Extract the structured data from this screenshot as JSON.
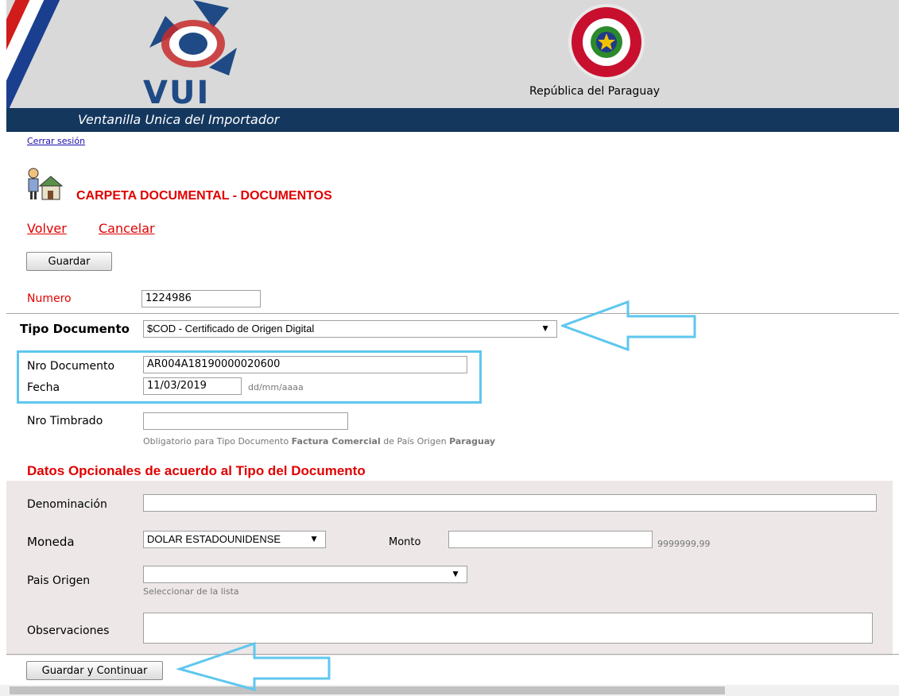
{
  "header": {
    "logo_text": "VUI",
    "country": "República del Paraguay",
    "tagline": "Ventanilla Unica del Importador"
  },
  "session": {
    "logout": "Cerrar sesión"
  },
  "page": {
    "title": "CARPETA DOCUMENTAL - DOCUMENTOS",
    "nav": {
      "back": "Volver",
      "cancel": "Cancelar"
    },
    "save": "Guardar",
    "save_continue": "Guardar y Continuar"
  },
  "form": {
    "numero": {
      "label": "Numero",
      "value": "1224986"
    },
    "tipo_documento": {
      "label": "Tipo Documento",
      "value": "$COD - Certificado de Origen Digital"
    },
    "nro_documento": {
      "label": "Nro Documento",
      "value": "AR004A18190000020600"
    },
    "fecha": {
      "label": "Fecha",
      "value": "11/03/2019",
      "format_hint": "dd/mm/aaaa"
    },
    "nro_timbrado": {
      "label": "Nro Timbrado",
      "value": "",
      "hint_prefix": "Obligatorio para Tipo Documento ",
      "hint_bold1": "Factura Comercial",
      "hint_mid": " de País Origen ",
      "hint_bold2": "Paraguay"
    }
  },
  "optional": {
    "title": "Datos Opcionales de acuerdo al Tipo del Documento",
    "denominacion": {
      "label": "Denominación",
      "value": ""
    },
    "moneda": {
      "label": "Moneda",
      "value": "DOLAR ESTADOUNIDENSE"
    },
    "monto": {
      "label": "Monto",
      "value": "",
      "format_hint": "9999999,99"
    },
    "pais_origen": {
      "label": "Pais Origen",
      "value": "",
      "hint": "Seleccionar de la lista"
    },
    "observaciones": {
      "label": "Observaciones",
      "value": ""
    }
  },
  "icons": [
    "recycle-logo-icon",
    "paraguay-seal-icon",
    "user-house-icon",
    "dropdown-caret-icon",
    "arrow-annotation-icon"
  ],
  "colors": {
    "accent_red": "#e00000",
    "banner_blue": "#14375e",
    "highlight": "#5ec7ee",
    "optional_bg": "#ede7e7"
  }
}
